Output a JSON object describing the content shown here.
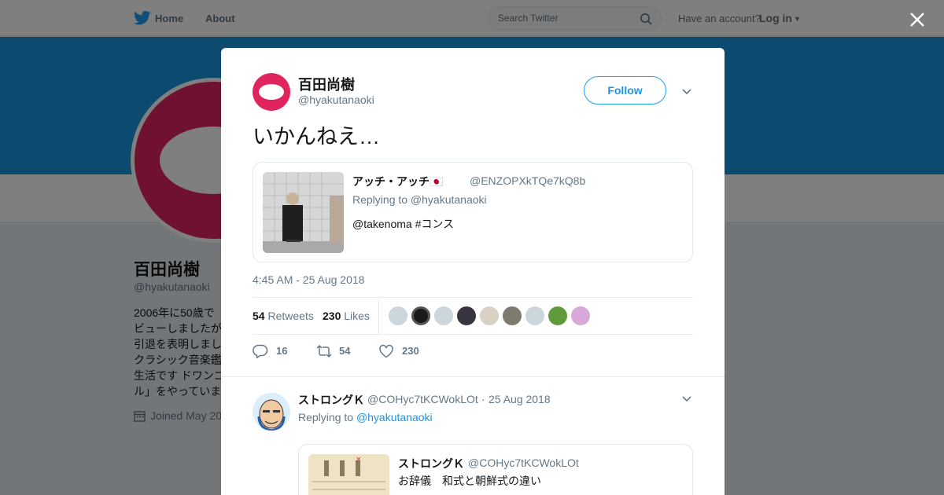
{
  "nav": {
    "home": "Home",
    "about": "About",
    "search_placeholder": "Search Twitter",
    "have_account": "Have an account?",
    "login": "Log in"
  },
  "profile": {
    "name": "百田尚樹",
    "handle": "@hyakutanaoki",
    "bio_lines": [
      "2006年に50歳で",
      "ビューしましたが",
      "引退を表明しまし",
      "クラシック音楽鑑",
      "生活です ドワンゴ",
      "ル」をやっていま"
    ],
    "joined": "Joined May 20"
  },
  "tweet": {
    "name": "百田尚樹",
    "handle": "@hyakutanaoki",
    "follow_label": "Follow",
    "text": "いかんねえ…",
    "time": "4:45 AM - 25 Aug 2018",
    "retweets_count": "54",
    "retweets_label": "Retweets",
    "likes_count": "230",
    "likes_label": "Likes",
    "quote": {
      "name": "アッチ・アッチ🇯🇵",
      "handle": "@ENZOPXkTQe7kQ8b",
      "replying": "Replying to @hyakutanaoki",
      "body": "@takenoma #コンス"
    },
    "actions": {
      "replies": "16",
      "retweets": "54",
      "likes": "230"
    }
  },
  "reply": {
    "name": "ストロングＫ",
    "handle": "@COHyc7tKCWokLOt",
    "sep": "·",
    "date": "25 Aug 2018",
    "replying_prefix": "Replying to",
    "replying_handle": "@hyakutanaoki",
    "quote": {
      "name": "ストロングＫ",
      "handle": "@COHyc7tKCWokLOt",
      "body": "お辞儀　和式と朝鮮式の違い"
    }
  },
  "colors": {
    "brand": "#1da1f2",
    "banner": "#1b95e0",
    "avatar": "#e0245e"
  }
}
